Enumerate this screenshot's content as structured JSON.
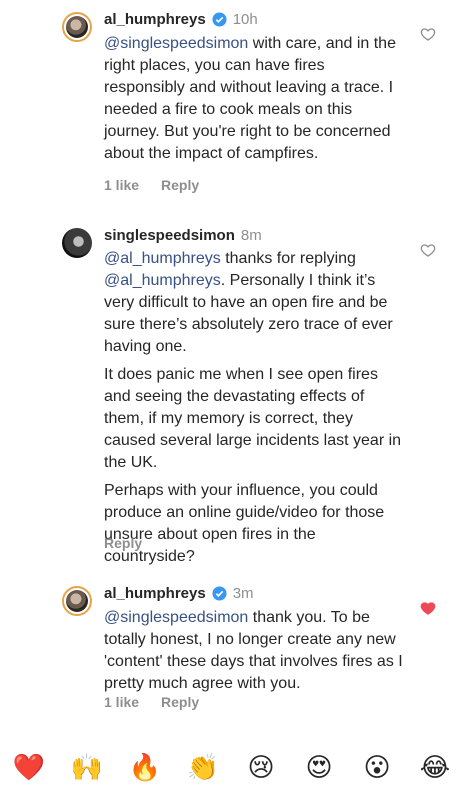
{
  "comments": [
    {
      "username": "al_humphreys",
      "time": "10h",
      "paragraphs": [
        {
          "mention": "@singlespeedsimon",
          "text": " with care, and in the right places, you can have fires responsibly and without leaving a trace. I needed a fire to cook meals on this journey. But you're right to be concerned about the impact of campfires."
        }
      ],
      "likes": "1 like",
      "reply": "Reply",
      "liked": false
    },
    {
      "username": "singlespeedsimon",
      "time": "8m",
      "paragraphs": [
        {
          "mention": "@al_humphreys",
          "text": " thanks for replying ",
          "mention2": "@al_humphreys",
          "text2": ". Personally I think it’s very difficult to have an open fire and be sure there’s absolutely zero trace of ever having one."
        },
        {
          "text": "It does panic me when I see open fires and seeing the devastating effects of them, if my memory is correct, they caused several large incidents last year in the UK."
        },
        {
          "text": "Perhaps with your influence, you could produce an online guide/video for those unsure about open fires in the countryside?"
        }
      ],
      "reply": "Reply",
      "liked": false
    },
    {
      "username": "al_humphreys",
      "time": "3m",
      "paragraphs": [
        {
          "mention": "@singlespeedsimon",
          "text": " thank you. To be totally honest, I no longer create any new 'content' these days that involves fires as I pretty much agree with you."
        }
      ],
      "likes": "1 like",
      "reply": "Reply",
      "liked": true
    }
  ],
  "reactions": [
    "❤️",
    "🙌",
    "🔥",
    "👏",
    "😢",
    "😍",
    "😮",
    "😂"
  ],
  "colors": {
    "mention": "#385185",
    "muted": "#8e8e8e",
    "liked": "#ed4956",
    "verified": "#3897f0"
  }
}
